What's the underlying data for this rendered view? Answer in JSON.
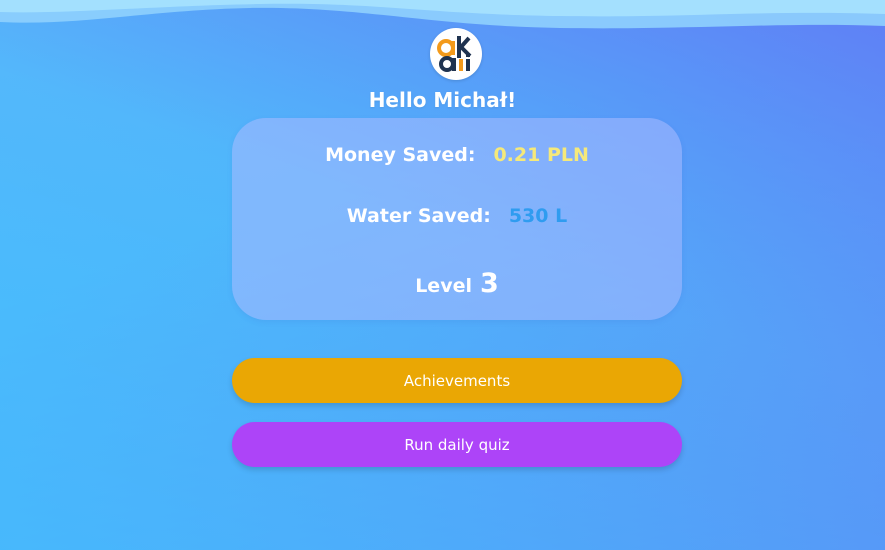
{
  "header": {
    "logo_icon": "akai-logo-icon",
    "greeting": "Hello Michał!"
  },
  "stats": {
    "money_label": "Money Saved:",
    "money_value": "0.21 PLN",
    "water_label": "Water Saved:",
    "water_value": "530 L",
    "level_label": "Level",
    "level_value": "3"
  },
  "buttons": {
    "achievements": "Achievements",
    "quiz": "Run daily quiz"
  },
  "colors": {
    "money_value": "#f5e97a",
    "water_value": "#2f9cf0",
    "achievements_button": "#eaa704",
    "quiz_button": "#ad44f8"
  }
}
